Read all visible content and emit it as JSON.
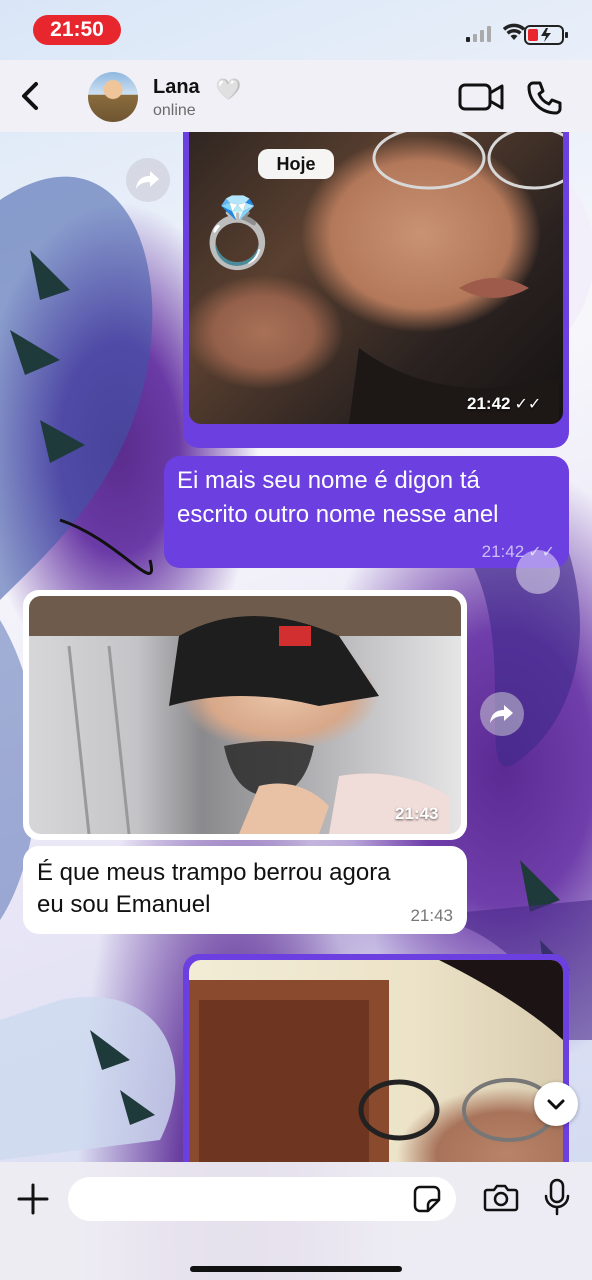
{
  "status_bar": {
    "time": "21:50"
  },
  "header": {
    "contact_name": "Lana",
    "heart": "🤍",
    "status": "online"
  },
  "date_chip": "Hoje",
  "messages": [
    {
      "type": "image",
      "direction": "out",
      "time": "21:42",
      "ticks": "✓✓",
      "emoji": "💍"
    },
    {
      "type": "text",
      "direction": "out",
      "text_line1": "Ei mais seu nome é digon tá",
      "text_line2": "escrito outro nome nesse anel",
      "time": "21:42",
      "ticks": "✓✓"
    },
    {
      "type": "image",
      "direction": "in",
      "time": "21:43"
    },
    {
      "type": "text",
      "direction": "in",
      "text_line1": "É que meus trampo berrou agora",
      "text_line2": "eu sou Emanuel",
      "time": "21:43"
    },
    {
      "type": "image",
      "direction": "out"
    }
  ],
  "composer": {
    "placeholder": ""
  },
  "colors": {
    "outgoing": "#6b3fe0",
    "incoming": "#ffffff",
    "time_pill": "#e8262d"
  },
  "icons": [
    "back-chevron-icon",
    "video-call-icon",
    "phone-icon",
    "forward-icon",
    "chevron-down-icon",
    "plus-icon",
    "sticker-icon",
    "camera-icon",
    "mic-icon",
    "signal-icon",
    "wifi-icon",
    "battery-icon"
  ]
}
